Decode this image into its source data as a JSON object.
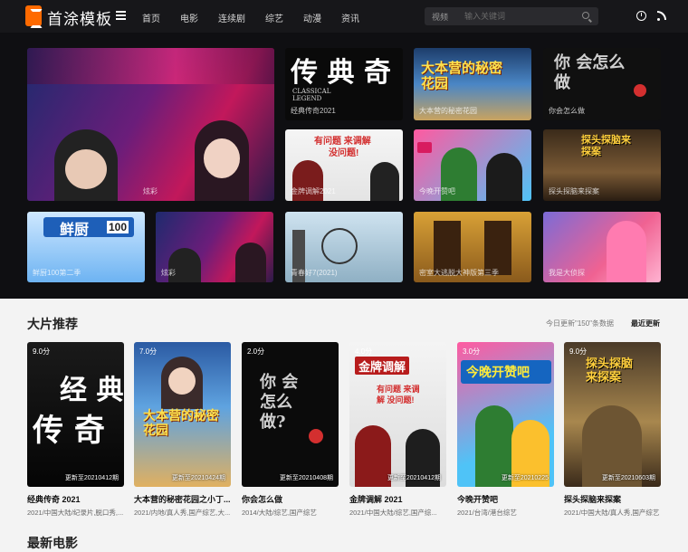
{
  "header": {
    "brand": "首涂模板",
    "nav": [
      "首页",
      "电影",
      "连续剧",
      "综艺",
      "动漫",
      "资讯"
    ],
    "search": {
      "category": "视频",
      "placeholder": "输入关键词"
    }
  },
  "banner": {
    "tiles": [
      {
        "caption": "炫彩"
      },
      {
        "caption": "经典传奇2021"
      },
      {
        "caption": "大本营的秘密花园"
      },
      {
        "caption": "你会怎么做"
      },
      {
        "caption": "金牌调解2021"
      },
      {
        "caption": "今晚开赞吧"
      },
      {
        "caption": "探头探脑来探案"
      },
      {
        "caption": "鲜厨100第二季"
      },
      {
        "caption": "炫彩"
      },
      {
        "caption": "青春好7(2021)"
      },
      {
        "caption": "密室大逃脱大神版第三季"
      },
      {
        "caption": "我是大侦探"
      }
    ],
    "texts": {
      "classic": "传 典 奇",
      "classic_en": "CLASSICAL LEGEND",
      "secret": "大本营的秘密花园",
      "you": "你 会怎么做",
      "gold1": "有问题 来调解",
      "gold2": "没问题!",
      "xian": "鲜厨",
      "xian_num": "100",
      "tan": "探头探脑来探案"
    }
  },
  "section": {
    "title": "大片推荐",
    "note": "今日更新\"150\"条数据",
    "link": "最近更新",
    "posters": [
      {
        "score": "9.0分",
        "update": "更新至20210412期",
        "title": "经典传奇 2021",
        "meta": "2021/中国大陆/纪录片,脱口秀,..."
      },
      {
        "score": "7.0分",
        "update": "更新至20210424期",
        "title": "大本营的秘密花园之小丁...",
        "meta": "2021/内地/真人秀,国产综艺,大..."
      },
      {
        "score": "2.0分",
        "update": "更新至20210408期",
        "title": "你会怎么做",
        "meta": "2014/大陆/综艺,国产综艺"
      },
      {
        "score": "4.0分",
        "update": "更新至20210412期",
        "title": "金牌调解 2021",
        "meta": "2021/中国大陆/综艺,国产综..."
      },
      {
        "score": "3.0分",
        "update": "更新至20210225",
        "title": "今晚开赞吧",
        "meta": "2021/台湾/港台综艺"
      },
      {
        "score": "9.0分",
        "update": "更新至20210603期",
        "title": "探头探脑来探案",
        "meta": "2021/中国大陆/真人秀,国产综艺"
      }
    ],
    "poster_texts": {
      "classic": "经 典",
      "classic2": "传 奇",
      "secret": "大本营的秘密花园",
      "you": "你 会怎么做?",
      "gold": "金牌调解",
      "gold_sub": "有问题 来调解 没问题!",
      "tonight": "今晚开赞吧",
      "tan": "探头探脑来探案"
    }
  },
  "next_section": {
    "title": "最新电影"
  },
  "colors": {
    "accent": "#ff6a00",
    "header_bg": "#17171a",
    "banner_bg": "#0f0f12"
  }
}
